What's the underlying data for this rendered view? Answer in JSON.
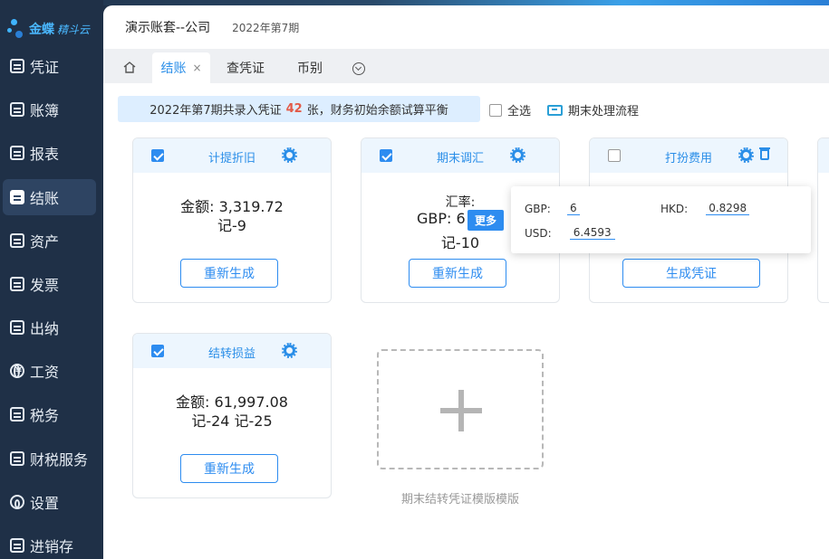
{
  "app": {
    "brand": "金蝶",
    "sub": "精斗云"
  },
  "sidebar": {
    "items": [
      {
        "label": "凭证",
        "icon": "voucher-icon"
      },
      {
        "label": "账簿",
        "icon": "ledger-icon"
      },
      {
        "label": "报表",
        "icon": "report-icon"
      },
      {
        "label": "结账",
        "icon": "closing-icon",
        "active": true
      },
      {
        "label": "资产",
        "icon": "asset-icon"
      },
      {
        "label": "发票",
        "icon": "invoice-icon"
      },
      {
        "label": "出纳",
        "icon": "cashier-icon"
      },
      {
        "label": "工资",
        "icon": "salary-icon"
      },
      {
        "label": "税务",
        "icon": "tax-icon"
      },
      {
        "label": "财税服务",
        "icon": "tax-service-icon"
      },
      {
        "label": "设置",
        "icon": "settings-icon"
      },
      {
        "label": "进销存",
        "icon": "inventory-icon"
      }
    ]
  },
  "header": {
    "account": "演示账套--公司",
    "period": "2022年第7期"
  },
  "tabs": [
    {
      "label": "结账",
      "active": true,
      "close": "×"
    },
    {
      "label": "查凭证"
    },
    {
      "label": "币别"
    }
  ],
  "notice": {
    "prefix": "2022年第7期共录入凭证",
    "count": "42",
    "suffix": "张，财务初始余额试算平衡"
  },
  "select_all_label": "全选",
  "flow_label": "期末处理流程",
  "cards": [
    {
      "title": "计提折旧",
      "checked": true,
      "amount_line": "金额:   3,319.72",
      "voucher": "记-9",
      "button": "重新生成"
    },
    {
      "title": "期末调汇",
      "checked": true,
      "rate_label": "汇率:",
      "rate_line": "GBP: 6",
      "voucher": "记-10",
      "button": "重新生成",
      "more": "更多"
    },
    {
      "title": "打扮费用",
      "checked": false,
      "button": "生成凭证"
    },
    {
      "title": "结转损益",
      "checked": true,
      "amount_line": "金额:   61,997.08",
      "voucher": "记-24 记-25",
      "button": "重新生成"
    }
  ],
  "popover": {
    "rates": [
      {
        "code": "GBP:",
        "value": "6"
      },
      {
        "code": "HKD:",
        "value": "0.8298"
      },
      {
        "code": "USD:",
        "value": "6.4593"
      }
    ]
  },
  "add_template_label": "期末结转凭证模版模版",
  "colors": {
    "accent": "#2d8cf0",
    "sidebar": "#1f3047",
    "highlight": "#e35a48"
  }
}
